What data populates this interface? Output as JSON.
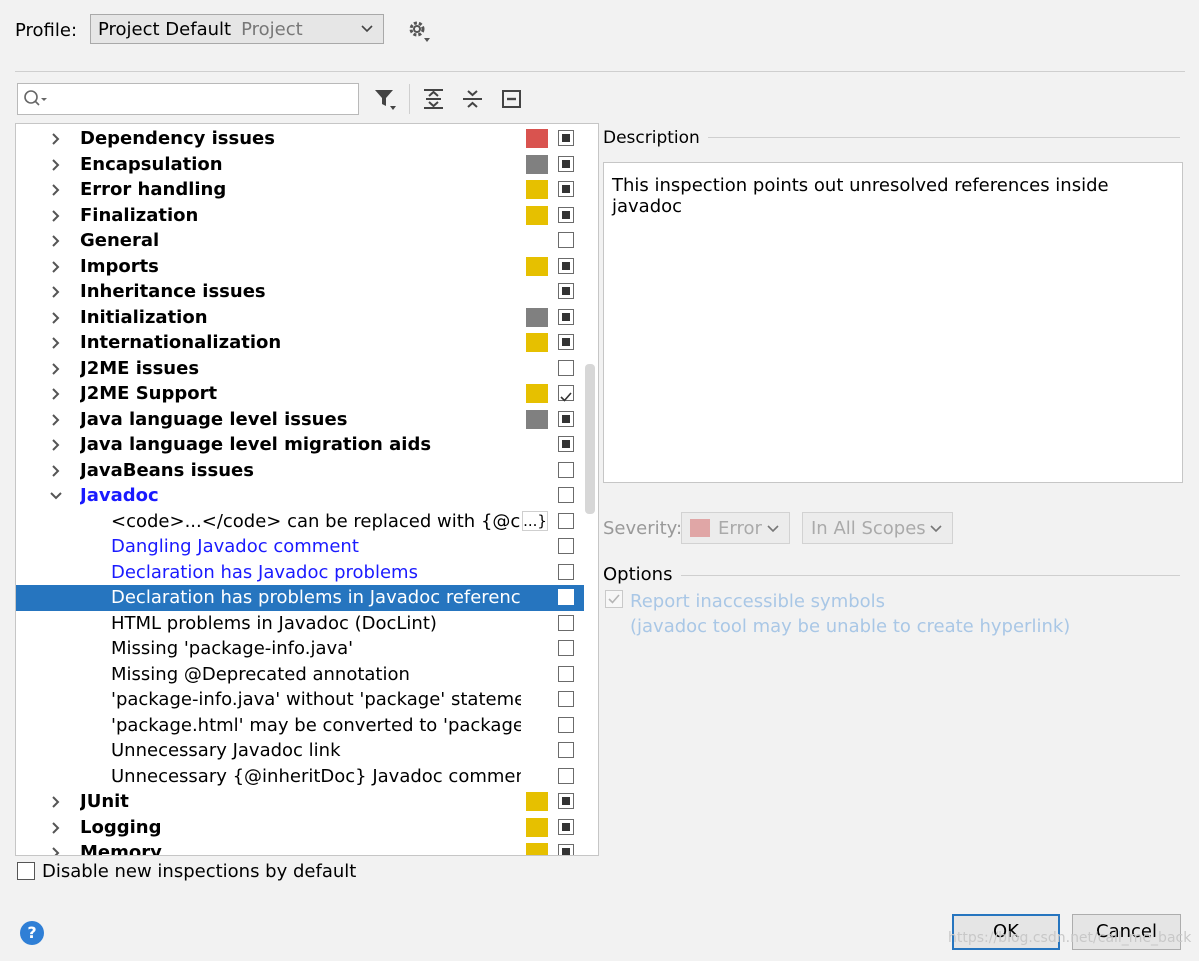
{
  "profile": {
    "label": "Profile:",
    "name": "Project Default",
    "kind": "Project"
  },
  "toolbar": {
    "filter_icon": "filter-icon",
    "expand_icon": "expand-all-icon",
    "collapse_icon": "collapse-all-icon",
    "reset_icon": "reset-icon"
  },
  "search": {
    "value": "",
    "placeholder": ""
  },
  "tree": {
    "rows": [
      {
        "type": "cat",
        "label": "Dependency issues",
        "severity": "#d9534f",
        "check": "mixed"
      },
      {
        "type": "cat",
        "label": "Encapsulation",
        "severity": "#808080",
        "check": "mixed"
      },
      {
        "type": "cat",
        "label": "Error handling",
        "severity": "#e6c000",
        "check": "mixed"
      },
      {
        "type": "cat",
        "label": "Finalization",
        "severity": "#e6c000",
        "check": "mixed"
      },
      {
        "type": "cat",
        "label": "General",
        "severity": "",
        "check": "unchecked"
      },
      {
        "type": "cat",
        "label": "Imports",
        "severity": "#e6c000",
        "check": "mixed"
      },
      {
        "type": "cat",
        "label": "Inheritance issues",
        "severity": "",
        "check": "mixed"
      },
      {
        "type": "cat",
        "label": "Initialization",
        "severity": "#808080",
        "check": "mixed"
      },
      {
        "type": "cat",
        "label": "Internationalization",
        "severity": "#e6c000",
        "check": "mixed"
      },
      {
        "type": "cat",
        "label": "J2ME issues",
        "severity": "",
        "check": "unchecked"
      },
      {
        "type": "cat",
        "label": "J2ME Support",
        "severity": "#e6c000",
        "check": "checked"
      },
      {
        "type": "cat",
        "label": "Java language level issues",
        "severity": "#808080",
        "check": "mixed"
      },
      {
        "type": "cat",
        "label": "Java language level migration aids",
        "severity": "",
        "check": "mixed"
      },
      {
        "type": "cat",
        "label": "JavaBeans issues",
        "severity": "",
        "check": "unchecked"
      },
      {
        "type": "cat-open",
        "label": "Javadoc",
        "severity": "",
        "check": "unchecked",
        "color": "#1a1aff"
      },
      {
        "type": "child",
        "label": "<code>...</code> can be replaced with {@code",
        "severity": "",
        "check": "unchecked",
        "ellipsis": "...}"
      },
      {
        "type": "child",
        "label": "Dangling Javadoc comment",
        "severity": "",
        "check": "unchecked",
        "color": "#1a1aff"
      },
      {
        "type": "child",
        "label": "Declaration has Javadoc problems",
        "severity": "",
        "check": "unchecked",
        "color": "#1a1aff"
      },
      {
        "type": "child",
        "label": "Declaration has problems in Javadoc references",
        "severity": "",
        "check": "unchecked",
        "selected": true
      },
      {
        "type": "child",
        "label": "HTML problems in Javadoc (DocLint)",
        "severity": "",
        "check": "unchecked"
      },
      {
        "type": "child",
        "label": "Missing 'package-info.java'",
        "severity": "",
        "check": "unchecked"
      },
      {
        "type": "child",
        "label": "Missing @Deprecated annotation",
        "severity": "",
        "check": "unchecked"
      },
      {
        "type": "child",
        "label": "'package-info.java' without 'package' statement",
        "severity": "",
        "check": "unchecked"
      },
      {
        "type": "child",
        "label": "'package.html' may be converted to 'package-info.java'",
        "severity": "",
        "check": "unchecked"
      },
      {
        "type": "child",
        "label": "Unnecessary Javadoc link",
        "severity": "",
        "check": "unchecked"
      },
      {
        "type": "child",
        "label": "Unnecessary {@inheritDoc} Javadoc comment",
        "severity": "",
        "check": "unchecked"
      },
      {
        "type": "cat",
        "label": "JUnit",
        "severity": "#e6c000",
        "check": "mixed"
      },
      {
        "type": "cat",
        "label": "Logging",
        "severity": "#e6c000",
        "check": "mixed"
      },
      {
        "type": "cat",
        "label": "Memory",
        "severity": "#e6c000",
        "check": "mixed"
      }
    ]
  },
  "description": {
    "title": "Description",
    "text": "This inspection points out unresolved references inside javadoc"
  },
  "severity": {
    "label": "Severity:",
    "value": "Error",
    "swatch": "#e0a6a6",
    "scope": "In All Scopes"
  },
  "options": {
    "title": "Options",
    "checkbox_line1": "Report inaccessible symbols",
    "checkbox_line2": "(javadoc tool may be unable to create hyperlink)",
    "checked": true
  },
  "footer": {
    "disable_label": "Disable new inspections by default",
    "help": "?",
    "ok": "OK",
    "cancel": "Cancel",
    "watermark": "https://blog.csdn.net/call_me_back"
  }
}
